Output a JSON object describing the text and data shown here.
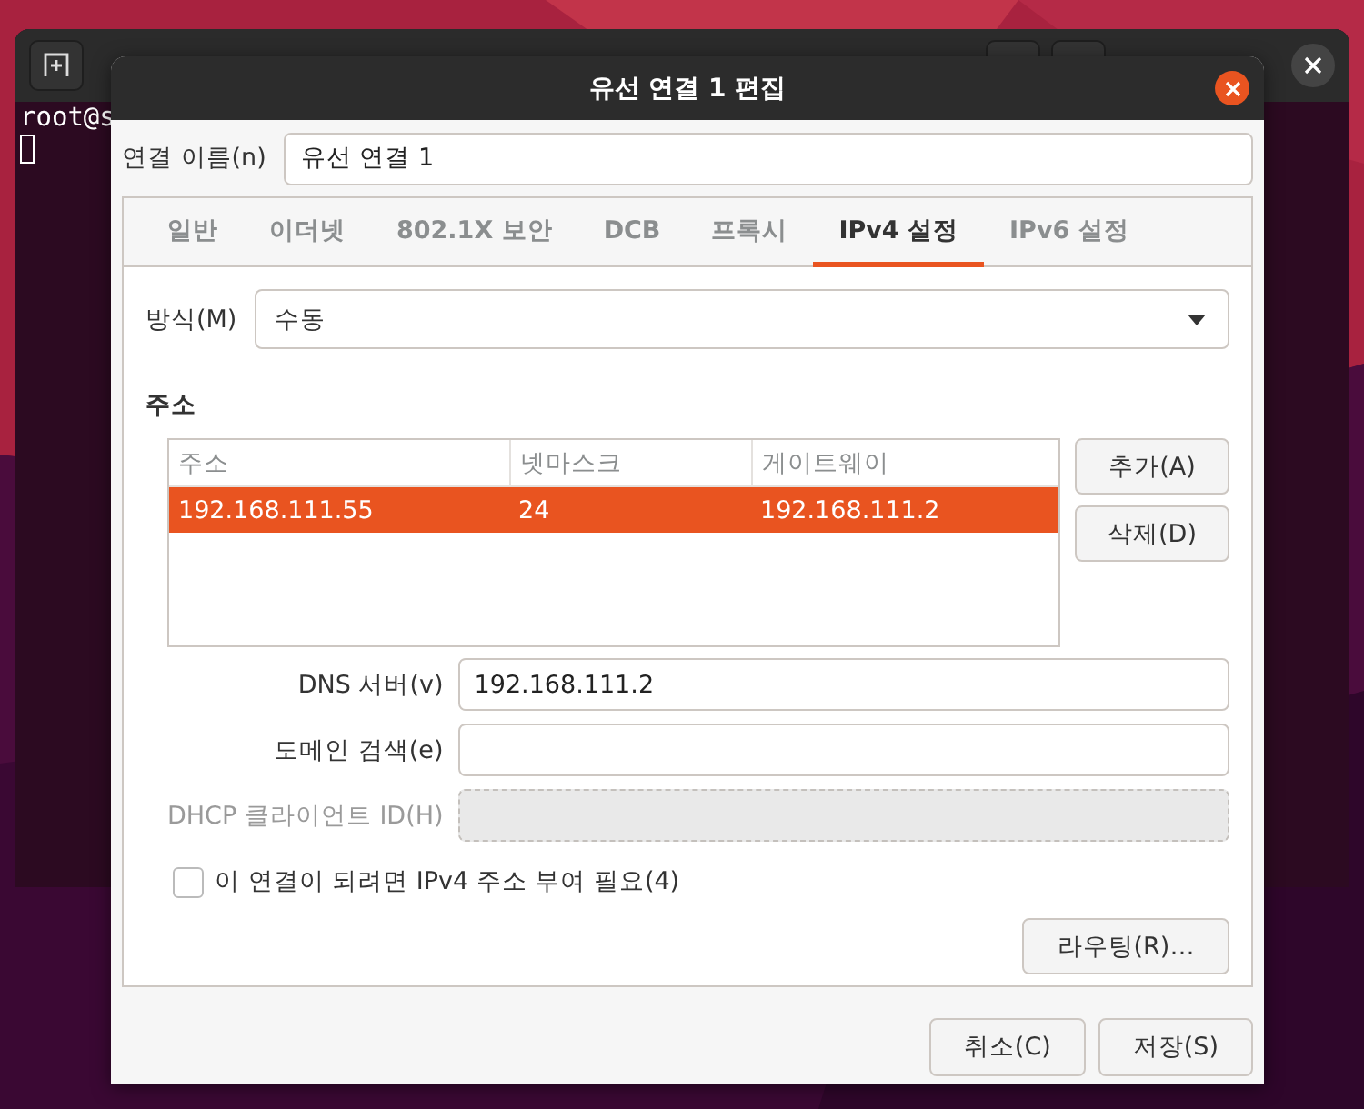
{
  "terminal": {
    "prompt": "root@s"
  },
  "dialog": {
    "title": "유선 연결 1 편집",
    "connection_name": {
      "label": "연결 이름(n)",
      "value": "유선 연결 1"
    },
    "tabs": [
      {
        "label": "일반",
        "selected": false
      },
      {
        "label": "이더넷",
        "selected": false
      },
      {
        "label": "802.1X 보안",
        "selected": false
      },
      {
        "label": "DCB",
        "selected": false
      },
      {
        "label": "프록시",
        "selected": false
      },
      {
        "label": "IPv4 설정",
        "selected": true
      },
      {
        "label": "IPv6 설정",
        "selected": false
      }
    ],
    "method": {
      "label": "방식(M)",
      "value": "수동"
    },
    "addresses": {
      "heading": "주소",
      "columns": [
        "주소",
        "넷마스크",
        "게이트웨이"
      ],
      "rows": [
        {
          "cells": [
            "192.168.111.55",
            "24",
            "192.168.111.2"
          ],
          "selected": true
        }
      ]
    },
    "address_buttons": [
      "추가(A)",
      "삭제(D)"
    ],
    "fields": [
      {
        "label": "DNS 서버(v)",
        "value": "192.168.111.2",
        "disabled": false
      },
      {
        "label": "도메인 검색(e)",
        "disabled": false
      },
      {
        "label": "DHCP 클라이언트 ID(H)",
        "disabled": true
      }
    ],
    "require_ipv4": {
      "label": "이 연결이 되려면 IPv4 주소 부여 필요(4)",
      "checked": false
    },
    "routes_button": "라우팅(R)…",
    "buttons": [
      "취소(C)",
      "저장(S)"
    ]
  }
}
